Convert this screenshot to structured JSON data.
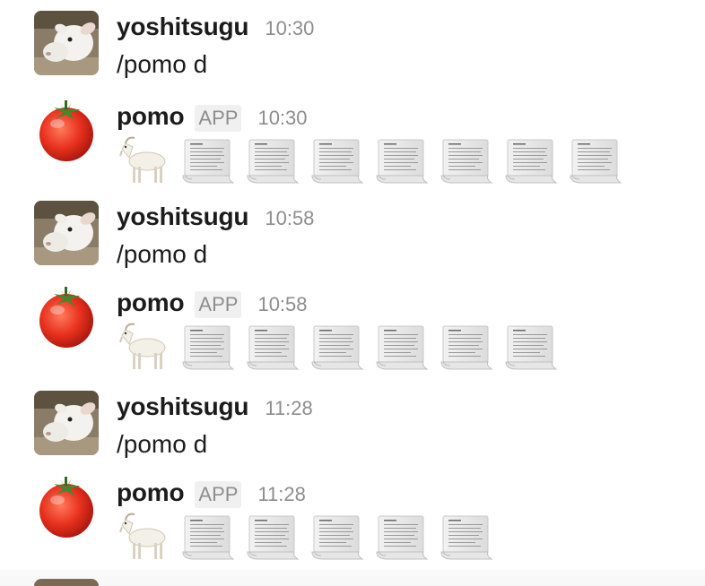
{
  "messages": [
    {
      "kind": "user",
      "name": "yoshitsugu",
      "time": "10:30",
      "text": "/pomo d"
    },
    {
      "kind": "app",
      "name": "pomo",
      "badge": "APP",
      "time": "10:30",
      "scrolls": 7
    },
    {
      "kind": "user",
      "name": "yoshitsugu",
      "time": "10:58",
      "text": "/pomo d"
    },
    {
      "kind": "app",
      "name": "pomo",
      "badge": "APP",
      "time": "10:58",
      "scrolls": 6
    },
    {
      "kind": "user",
      "name": "yoshitsugu",
      "time": "11:28",
      "text": "/pomo d"
    },
    {
      "kind": "app",
      "name": "pomo",
      "badge": "APP",
      "time": "11:28",
      "scrolls": 5
    }
  ],
  "icons": {
    "user_avatar": "goat-avatar-icon",
    "app_avatar": "tomato-icon",
    "goat_emoji": "goat-icon",
    "scroll_emoji": "page-curl-icon"
  },
  "colors": {
    "text": "#1d1c1d",
    "muted": "#8d8d8d",
    "tomato": "#e8321f"
  }
}
